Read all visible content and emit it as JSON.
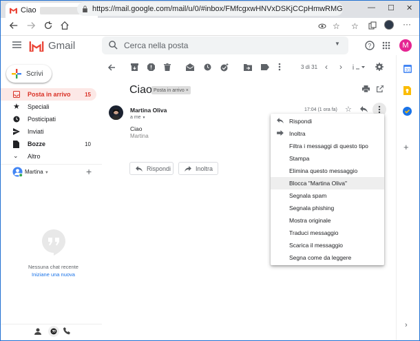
{
  "browser": {
    "tab_title": "Ciao",
    "url": "https://mail.google.com/mail/u/0/#inbox/FMfcgxwHNVxDSKjCCpHmwRMGhJ..."
  },
  "gmail": {
    "logo": "Gmail",
    "search_placeholder": "Cerca nella posta",
    "avatar_initial": "M",
    "accent": "#d93025"
  },
  "sidebar": {
    "compose": "Scrivi",
    "items": [
      {
        "label": "Posta in arrivo",
        "count": "15"
      },
      {
        "label": "Speciali",
        "count": ""
      },
      {
        "label": "Posticipati",
        "count": ""
      },
      {
        "label": "Inviati",
        "count": ""
      },
      {
        "label": "Bozze",
        "count": "10"
      },
      {
        "label": "Altro",
        "count": ""
      }
    ],
    "account": "Martina",
    "no_chat": "Nessuna chat recente",
    "start_chat": "Iniziane una nuova"
  },
  "toolbar": {
    "pagination": "3 di 31"
  },
  "message": {
    "subject": "Ciao",
    "label": "Posta in arrivo",
    "sender": "Martina Oliva",
    "to": "a me",
    "time": "17:04 (1 ora fa)",
    "body": "Ciao",
    "signature": "Martina",
    "reply": "Rispondi",
    "forward": "Inoltra"
  },
  "menu": {
    "items": [
      "Rispondi",
      "Inoltra",
      "Filtra i messaggi di questo tipo",
      "Stampa",
      "Elimina questo messaggio",
      "Blocca \"Martina Oliva\"",
      "Segnala spam",
      "Segnala phishing",
      "Mostra originale",
      "Traduci messaggio",
      "Scarica il messaggio",
      "Segna come da leggere"
    ]
  }
}
